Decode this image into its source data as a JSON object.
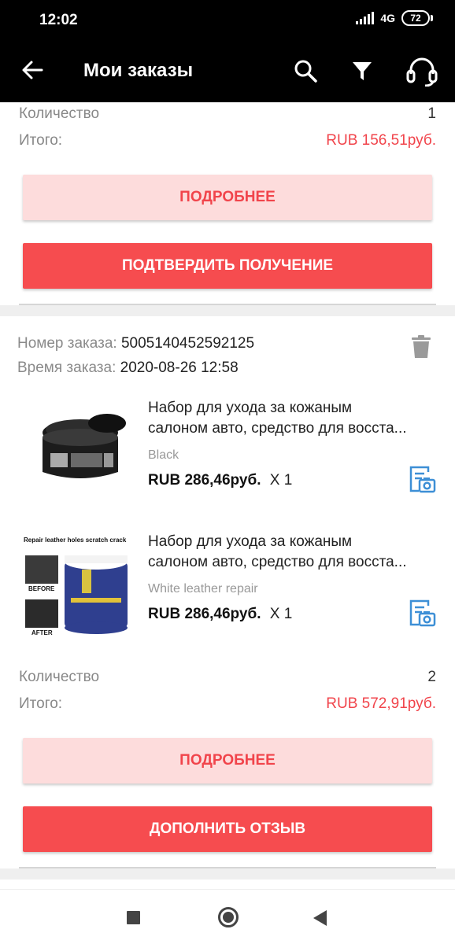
{
  "status_bar": {
    "time": "12:02",
    "network": "4G",
    "battery": "72"
  },
  "app_bar": {
    "title": "Мои заказы"
  },
  "order_prev": {
    "quantity_label": "Количество",
    "quantity_value": "1",
    "total_label": "Итого:",
    "total_value": "RUB 156,51руб.",
    "details_button": "ПОДРОБНЕЕ",
    "confirm_button": "ПОДТВЕРДИТЬ ПОЛУЧЕНИЕ"
  },
  "order": {
    "number_label": "Номер заказа:",
    "number_value": "5005140452592125",
    "time_label": "Время заказа:",
    "time_value": "2020-08-26 12:58",
    "items": [
      {
        "title_line1": "Набор для ухода за кожаным",
        "title_line2": "салоном авто, средство для восста...",
        "variant": "Black",
        "price": "RUB 286,46руб.",
        "qty": "X 1"
      },
      {
        "title_line1": "Набор для ухода за кожаным",
        "title_line2": "салоном авто, средство для восста...",
        "variant": "White leather repair",
        "price": "RUB 286,46руб.",
        "qty": "X 1",
        "image_caption": "Repair leather holes scratch crack",
        "image_before": "BEFORE",
        "image_after": "AFTER"
      }
    ],
    "quantity_label": "Количество",
    "quantity_value": "2",
    "total_label": "Итого:",
    "total_value": "RUB 572,91руб.",
    "details_button": "ПОДРОБНЕЕ",
    "review_button": "ДОПОЛНИТЬ ОТЗЫВ"
  },
  "colors": {
    "accent": "#f64c4f",
    "accent_light": "#fddcdc",
    "price": "#f1444b",
    "icon_blue": "#3d8fd6"
  },
  "icons": [
    "back-arrow-icon",
    "search-icon",
    "filter-icon",
    "support-headset-icon",
    "trash-icon",
    "photo-review-icon"
  ]
}
